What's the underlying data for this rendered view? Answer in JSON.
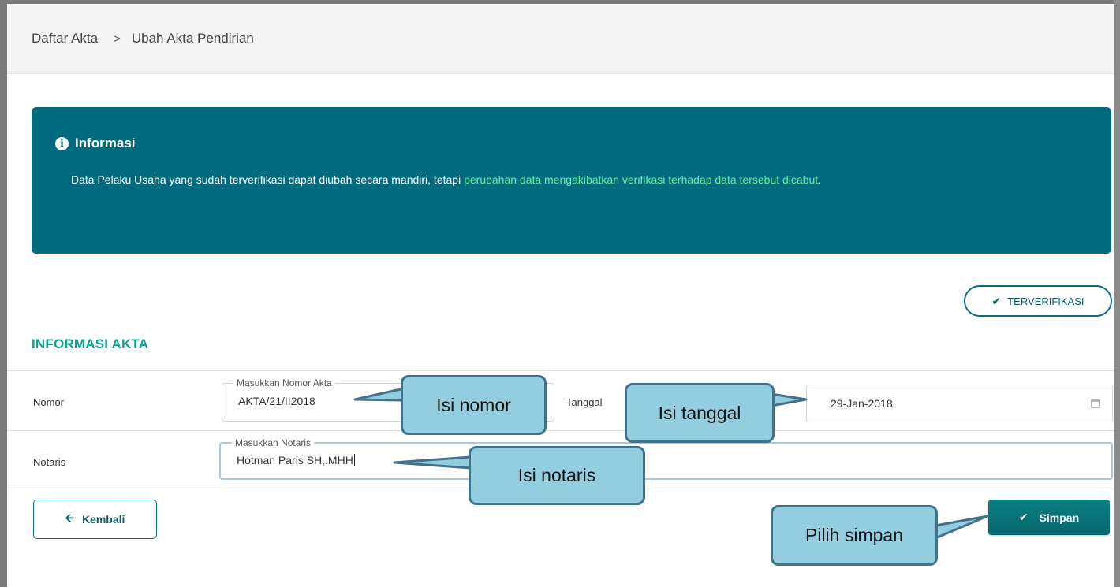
{
  "breadcrumb": {
    "root": "Daftar Akta",
    "separator": ">",
    "current": "Ubah Akta Pendirian"
  },
  "info": {
    "title": "Informasi",
    "text_before": "Data Pelaku Usaha yang sudah terverifikasi dapat diubah secara mandiri, tetapi ",
    "text_highlight": "perubahan data mengakibatkan verifikasi terhadap data tersebut dicabut",
    "text_after": ".",
    "background_color": "#006b7e",
    "highlight_color": "#63f0a0"
  },
  "status_badge": {
    "label": "TERVERIFIKASI",
    "icon": "check-icon"
  },
  "section": {
    "title": "INFORMASI AKTA"
  },
  "form": {
    "nomor": {
      "label": "Nomor",
      "legend": "Masukkan Nomor Akta",
      "value": "AKTA/21/II2018"
    },
    "tanggal": {
      "label": "Tanggal",
      "value": "29-Jan-2018",
      "icon": "calendar-icon"
    },
    "notaris": {
      "label": "Notaris",
      "legend": "Masukkan Notaris",
      "value": "Hotman Paris SH,.MHH"
    }
  },
  "buttons": {
    "back_label": "Kembali",
    "back_icon": "arrow-left-icon",
    "save_label": "Simpan",
    "save_icon": "check-icon",
    "accent_color": "#0a6e80"
  },
  "callouts": {
    "nomor": "Isi nomor",
    "tanggal": "Isi tanggal",
    "notaris": "Isi notaris",
    "simpan": "Pilih simpan"
  }
}
